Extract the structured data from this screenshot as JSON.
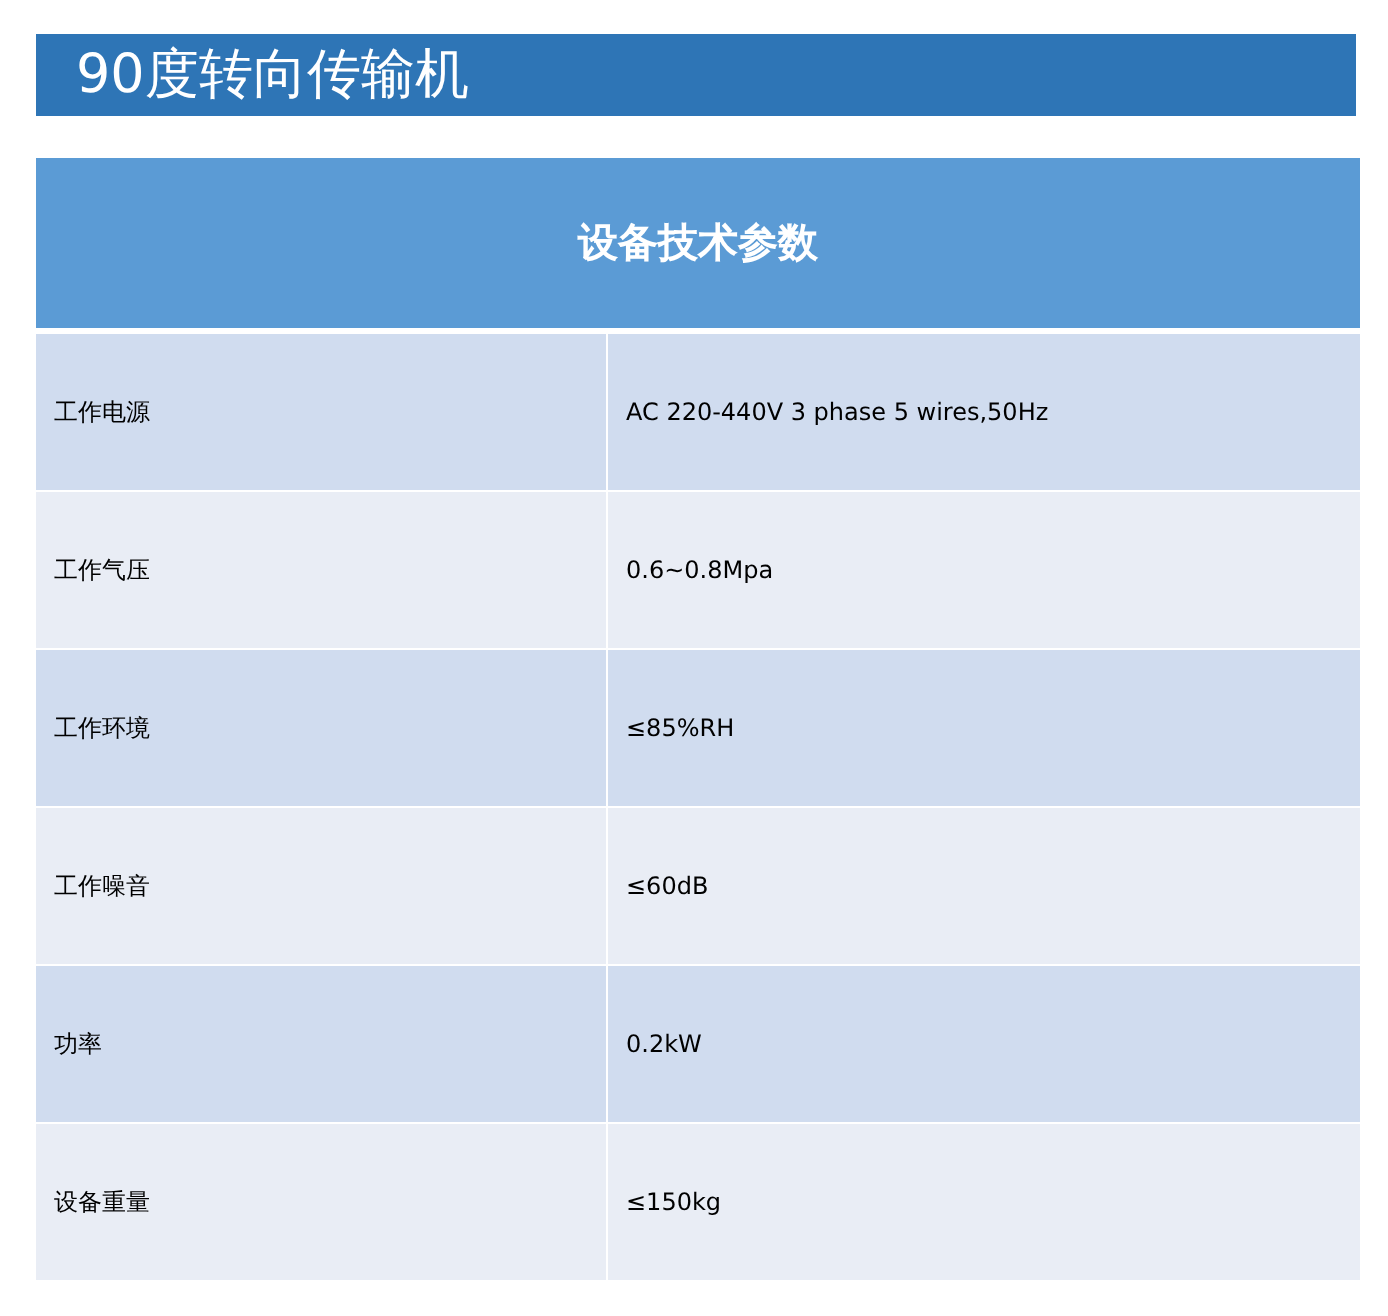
{
  "title": "90度转向传输机",
  "table": {
    "header": "设备技术参数",
    "rows": [
      {
        "label": "工作电源",
        "value": "AC 220-440V 3 phase 5 wires,50Hz"
      },
      {
        "label": "工作气压",
        "value": "0.6~0.8Mpa"
      },
      {
        "label": "工作环境",
        "value": "≤85%RH"
      },
      {
        "label": "工作噪音",
        "value": "≤60dB"
      },
      {
        "label": "功率",
        "value": "0.2kW"
      },
      {
        "label": "设备重量",
        "value": "≤150kg"
      }
    ]
  }
}
